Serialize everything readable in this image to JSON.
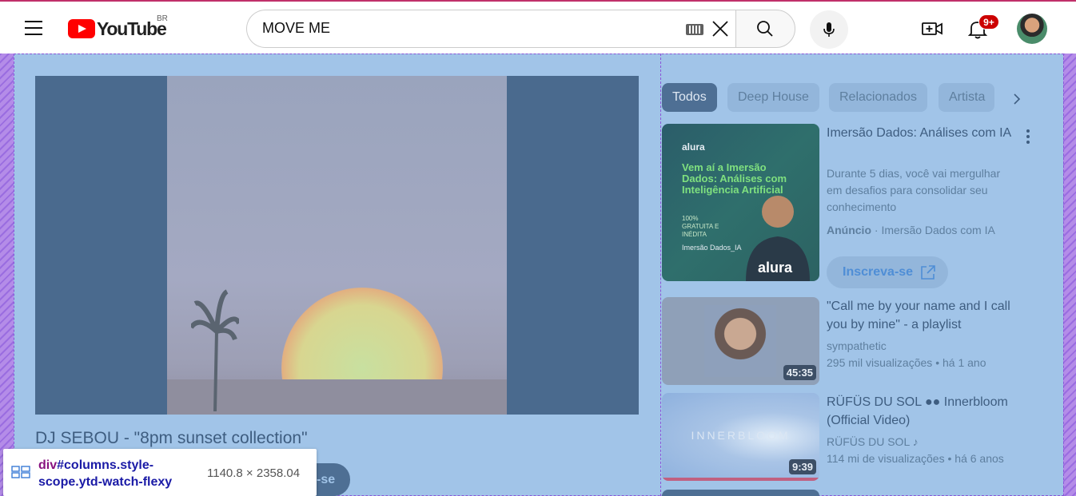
{
  "header": {
    "logo_text": "YouTube",
    "region": "BR",
    "search_value": "MOVE ME",
    "notification_count": "9+"
  },
  "video": {
    "title": "DJ SEBOU - \"8pm sunset collection\"",
    "subscribe_partial": "-se"
  },
  "chips": [
    "Todos",
    "Deep House",
    "Relacionados",
    "Artista"
  ],
  "sidebar": {
    "ad": {
      "title": "Imersão Dados: Análises com IA",
      "description": "Durante 5 dias, você vai mergulhar em desafios para consolidar seu conhecimento",
      "label": "Anúncio",
      "advertiser": "Imersão Dados com IA",
      "cta": "Inscreva-se",
      "thumb_brand": "alura",
      "thumb_headline": "Vem aí a Imersão Dados: Análises com Inteligência Artificial",
      "thumb_tag": "100% GRATUITA E INÉDITA",
      "thumb_footer": "Imersão Dados_IA",
      "thumb_shirt": "alura"
    },
    "videos": [
      {
        "title": "\"Call me by your name and I call you by mine\" - a playlist",
        "channel": "sympathetic",
        "views": "295 mil visualizações",
        "age": "há 1 ano",
        "duration": "45:35"
      },
      {
        "title": "RÜFÜS DU SOL ●● Innerbloom (Official Video)",
        "channel": "RÜFÜS DU SOL",
        "views": "114 mi de visualizações",
        "age": "há 6 anos",
        "duration": "9:39",
        "thumb_text": "INNERBLOOM"
      }
    ]
  },
  "inspector": {
    "tag": "div",
    "selector": "#columns.style-scope.ytd-watch-flexy",
    "size": "1140.8 × 2358.04"
  }
}
